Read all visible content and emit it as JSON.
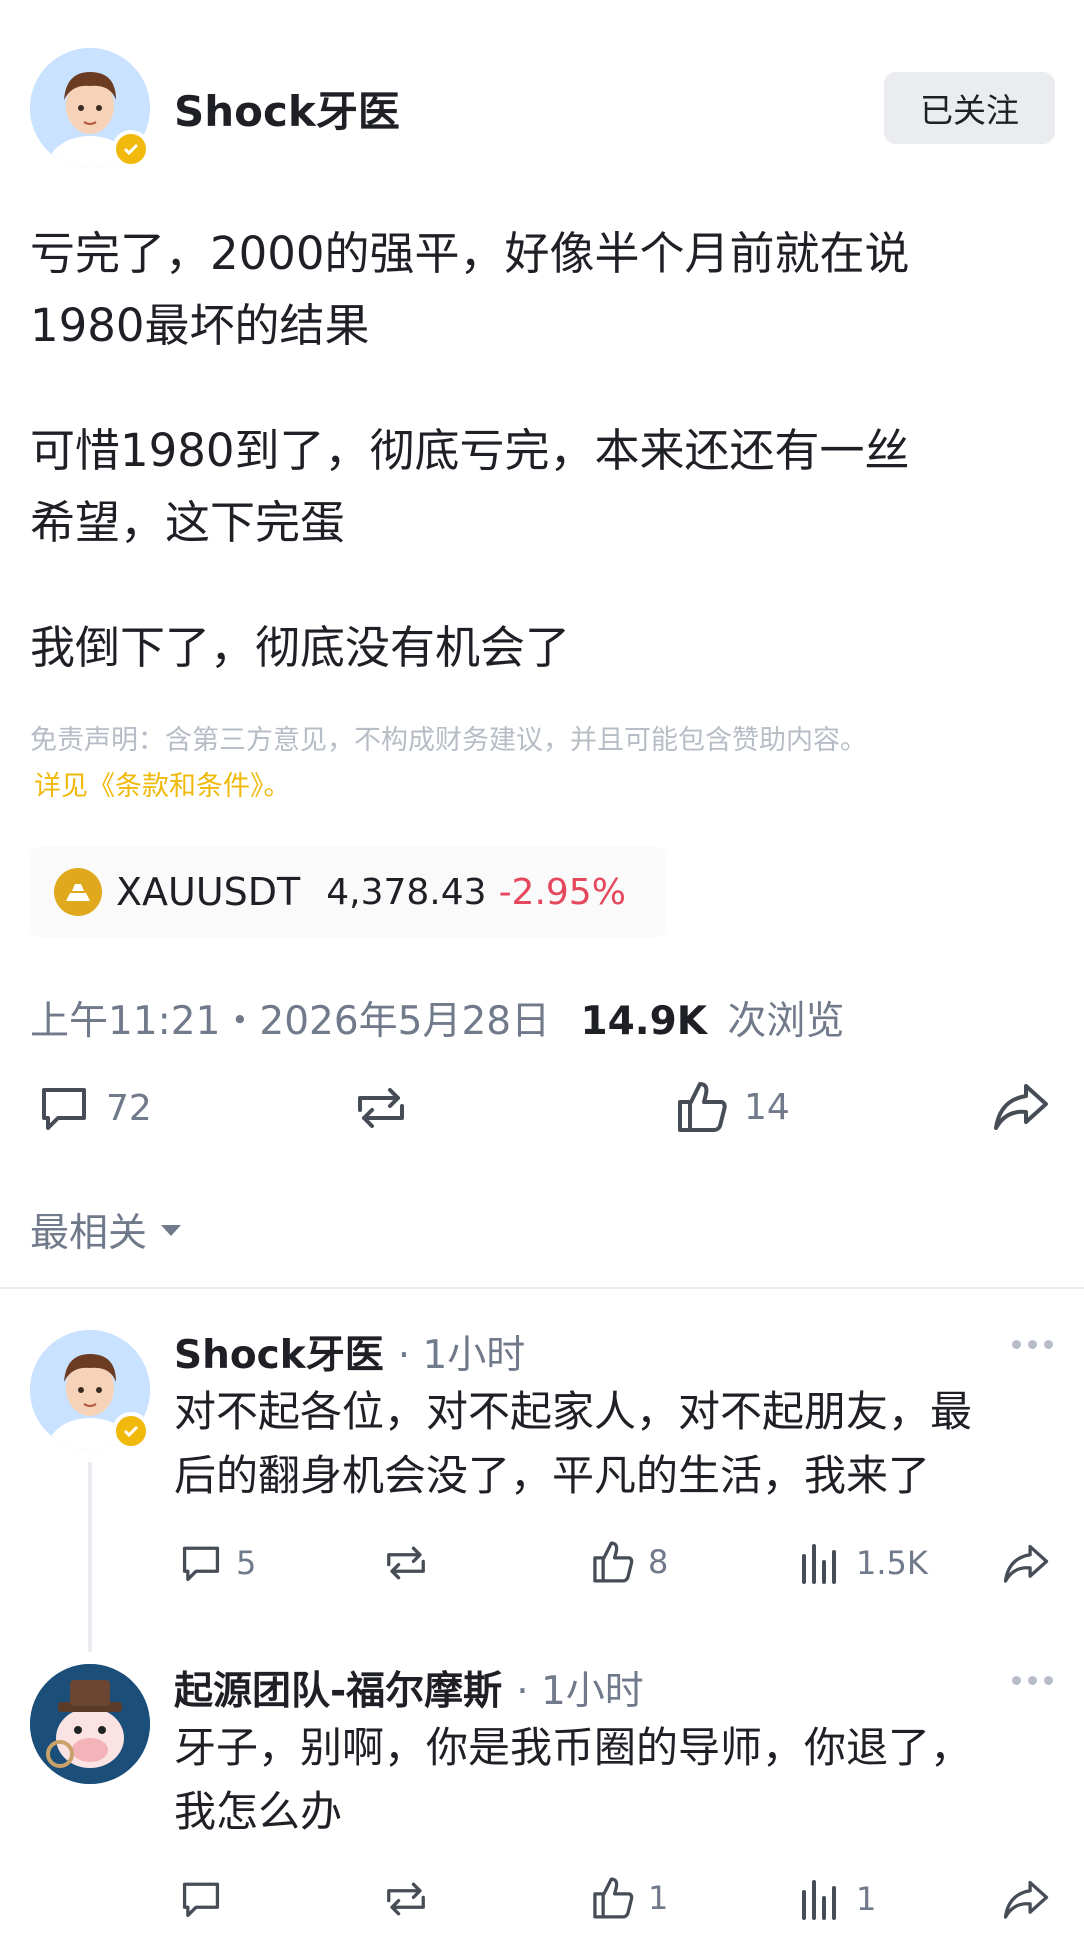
{
  "post": {
    "author": "Shock牙医",
    "follow_label": "已关注",
    "paragraphs": [
      "亏完了，2000的强平，好像半个月前就在说",
      "1980最坏的结果",
      "可惜1980到了，彻底亏完，本来还还有一丝",
      "希望，这下完蛋",
      "我倒下了，彻底没有机会了"
    ],
    "disclaimer": "免责声明：含第三方意见，不构成财务建议，并且可能包含赞助内容。",
    "terms": "详见《条款和条件》。",
    "ticker": {
      "symbol": "XAUUSDT",
      "price": "4,378.43",
      "change": "-2.95%"
    },
    "time": "上午11:21・2026年5月28日",
    "views_count": "14.9K",
    "views_label": "次浏览",
    "stats": {
      "comments": "72",
      "likes": "14"
    }
  },
  "sort_label": "最相关",
  "comments": [
    {
      "author": "Shock牙医",
      "time": "· 1小时",
      "lines": [
        "对不起各位，对不起家人，对不起朋友，最",
        "后的翻身机会没了，平凡的生活，我来了"
      ],
      "replies": "5",
      "likes": "8",
      "views": "1.5K"
    },
    {
      "author": "起源团队-福尔摩斯",
      "time": "· 1小时",
      "lines": [
        "牙子，别啊，你是我币圈的导师，你退了，",
        "我怎么办"
      ],
      "replies": "",
      "likes": "1",
      "views": "1"
    }
  ],
  "colors": {
    "accent": "#f0b90b",
    "negative": "#e5485c",
    "text": "#1e2026",
    "muted": "#707a8a"
  }
}
